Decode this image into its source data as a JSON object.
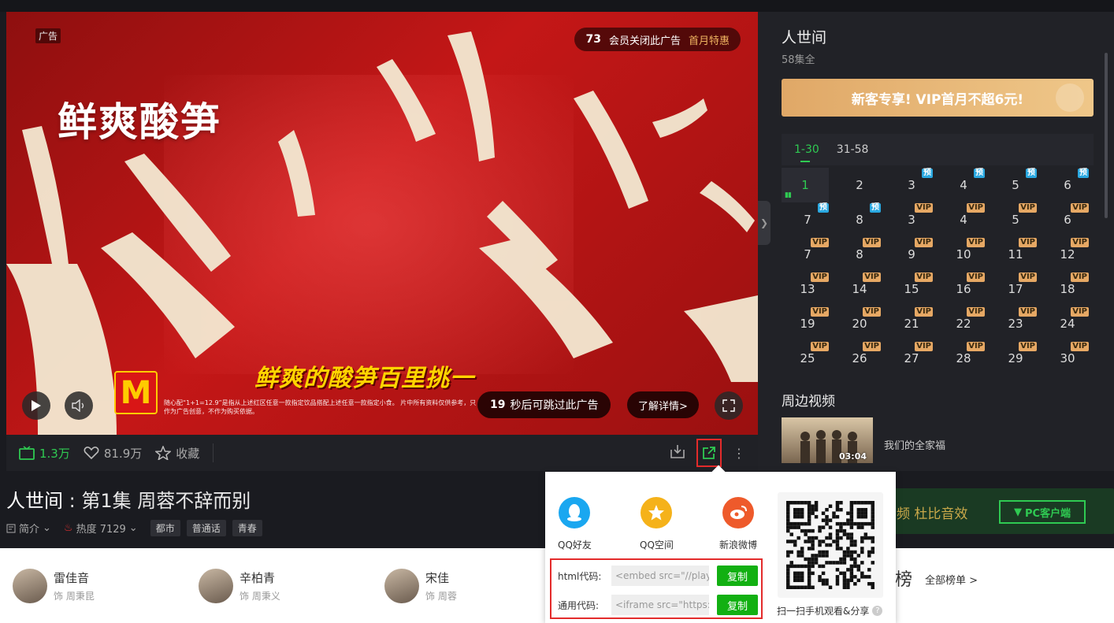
{
  "player": {
    "ad_tag": "广告",
    "ad_countdown": "73",
    "vip_close_text": "会员关闭此广告",
    "vip_offer": "首月特惠",
    "headline": "鲜爽酸笋",
    "slogan": "鲜爽的酸笋百里挑一",
    "brand_logo": "M",
    "fine_print": "随心配“1+1=12.9”是指从上述红区任意一款指定饮品搭配上述任意一款指定小食。 片中所有资料仅供参考，只作为广告创意，不作为购买依据。",
    "skip_seconds": "19",
    "skip_text": "秒后可跳过此广告",
    "learn_more": "了解详情>"
  },
  "stats": {
    "views": "1.3万",
    "likes": "81.9万",
    "collect": "收藏"
  },
  "episode": {
    "show": "人世间",
    "separator": " : ",
    "title": "第1集 周蓉不辞而别",
    "intro": "简介",
    "heat": "热度 7129",
    "tags": [
      "都市",
      "普通话",
      "青春"
    ]
  },
  "promo": {
    "text": "频  杜比音效",
    "pc_client": "PC客户端"
  },
  "cast": [
    {
      "name": "雷佳音",
      "role": "饰 周秉昆"
    },
    {
      "name": "辛柏青",
      "role": "饰 周秉义"
    },
    {
      "name": "宋佳",
      "role": "饰 周蓉"
    }
  ],
  "rank": {
    "title": "榜",
    "all": "全部榜单 >"
  },
  "sidebar": {
    "title": "人世间",
    "count": "58集全",
    "vip_banner": "新客专享! VIP首月不超6元!",
    "tabs": [
      "1-30",
      "31-58"
    ],
    "episodes": [
      {
        "n": "1",
        "badge": "",
        "active": true
      },
      {
        "n": "2",
        "badge": ""
      },
      {
        "n": "3",
        "badge": "预"
      },
      {
        "n": "4",
        "badge": "预"
      },
      {
        "n": "5",
        "badge": "预"
      },
      {
        "n": "6",
        "badge": "预"
      },
      {
        "n": "7",
        "badge": "预"
      },
      {
        "n": "8",
        "badge": "预"
      },
      {
        "n": "3",
        "badge": "VIP"
      },
      {
        "n": "4",
        "badge": "VIP"
      },
      {
        "n": "5",
        "badge": "VIP"
      },
      {
        "n": "6",
        "badge": "VIP"
      },
      {
        "n": "7",
        "badge": "VIP"
      },
      {
        "n": "8",
        "badge": "VIP"
      },
      {
        "n": "9",
        "badge": "VIP"
      },
      {
        "n": "10",
        "badge": "VIP"
      },
      {
        "n": "11",
        "badge": "VIP"
      },
      {
        "n": "12",
        "badge": "VIP"
      },
      {
        "n": "13",
        "badge": "VIP"
      },
      {
        "n": "14",
        "badge": "VIP"
      },
      {
        "n": "15",
        "badge": "VIP"
      },
      {
        "n": "16",
        "badge": "VIP"
      },
      {
        "n": "17",
        "badge": "VIP"
      },
      {
        "n": "18",
        "badge": "VIP"
      },
      {
        "n": "19",
        "badge": "VIP"
      },
      {
        "n": "20",
        "badge": "VIP"
      },
      {
        "n": "21",
        "badge": "VIP"
      },
      {
        "n": "22",
        "badge": "VIP"
      },
      {
        "n": "23",
        "badge": "VIP"
      },
      {
        "n": "24",
        "badge": "VIP"
      },
      {
        "n": "25",
        "badge": "VIP"
      },
      {
        "n": "26",
        "badge": "VIP"
      },
      {
        "n": "27",
        "badge": "VIP"
      },
      {
        "n": "28",
        "badge": "VIP"
      },
      {
        "n": "29",
        "badge": "VIP"
      },
      {
        "n": "30",
        "badge": "VIP"
      }
    ],
    "nearby_title": "周边视频",
    "nearby_video": {
      "title": "我们的全家福",
      "duration": "03:04"
    }
  },
  "share": {
    "qq_friend": "QQ好友",
    "qzone": "QQ空间",
    "weibo": "新浪微博",
    "html_label": "html代码:",
    "html_value": "<embed src=\"//player.",
    "generic_label": "通用代码:",
    "generic_value": "<iframe src=\"https://o",
    "copy": "复制",
    "qr_caption": "扫一扫手机观看&分享",
    "help": "?"
  },
  "colors": {
    "accent_green": "#2fca52",
    "vip_gold": "#e6a864",
    "preview_blue": "#2aa8e0",
    "highlight_red": "#e32b2b"
  }
}
